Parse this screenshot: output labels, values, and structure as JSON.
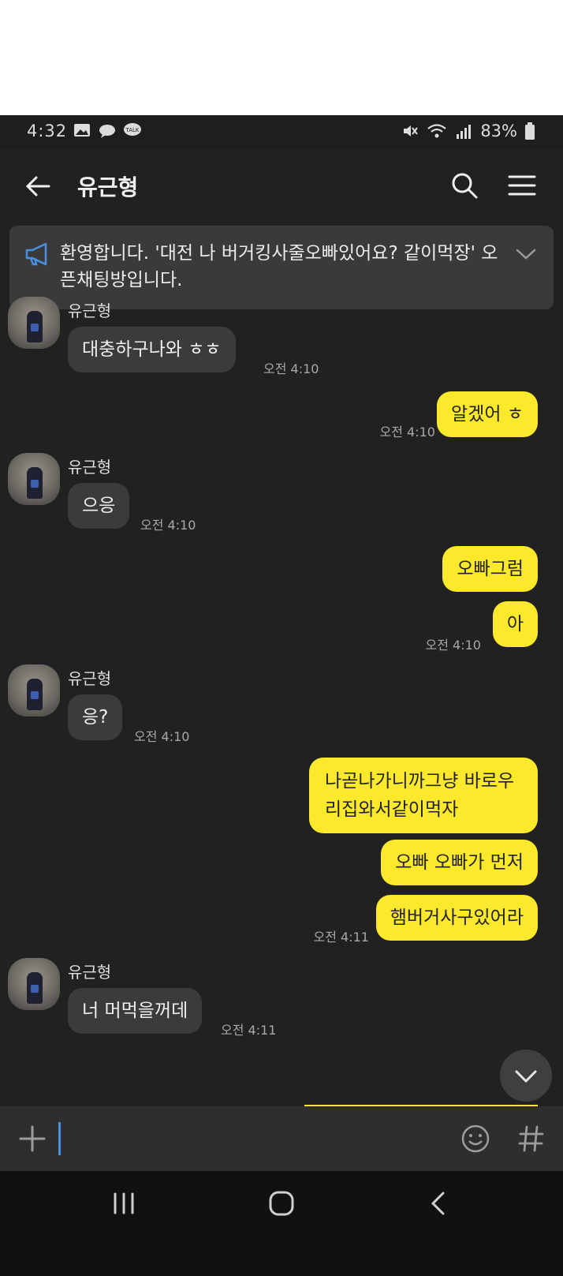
{
  "status_bar": {
    "time": "4:32",
    "battery": "83%",
    "icons": [
      "gallery-icon",
      "chat-bubble-icon",
      "talk-icon",
      "mute-icon",
      "wifi-icon",
      "signal-icon",
      "battery-icon"
    ]
  },
  "header": {
    "title": "유근형",
    "icons": [
      "back-arrow-icon",
      "search-icon",
      "menu-icon"
    ]
  },
  "notice": {
    "text": "환영합니다. '대전 나 버거킹사줄오빠있어요? 같이먹장' 오픈채팅방입니다.",
    "icons": [
      "megaphone-icon",
      "chevron-down-icon"
    ]
  },
  "messages": [
    {
      "dir": "in",
      "sender": "유근형",
      "text": "대충하구나와 ㅎㅎ",
      "time": "오전 4:10"
    },
    {
      "dir": "out",
      "text": "알겠어 ㅎ",
      "time": "오전 4:10"
    },
    {
      "dir": "in",
      "sender": "유근형",
      "text": "으응",
      "time": "오전 4:10"
    },
    {
      "dir": "out",
      "text": "오빠그럼",
      "time": ""
    },
    {
      "dir": "out",
      "text": "아",
      "time": "오전 4:10"
    },
    {
      "dir": "in",
      "sender": "유근형",
      "text": "응?",
      "time": "오전 4:10"
    },
    {
      "dir": "out",
      "text": "나곧나가니까그냥 바로우리집와서같이먹자",
      "time": ""
    },
    {
      "dir": "out",
      "text": "오빠 오빠가 먼저",
      "time": ""
    },
    {
      "dir": "out",
      "text": "햄버거사구있어라",
      "time": "오전 4:11"
    },
    {
      "dir": "in",
      "sender": "유근형",
      "text": "너 머먹을꺼데",
      "time": "오전 4:11"
    }
  ],
  "input_bar": {
    "placeholder": "",
    "icons": [
      "plus-icon",
      "emoji-icon",
      "hashtag-icon"
    ]
  },
  "colors": {
    "background": "#212121",
    "incoming_bubble": "#3b3b3b",
    "outgoing_bubble": "#fde92b",
    "notice_bg": "#3a3a3a"
  }
}
